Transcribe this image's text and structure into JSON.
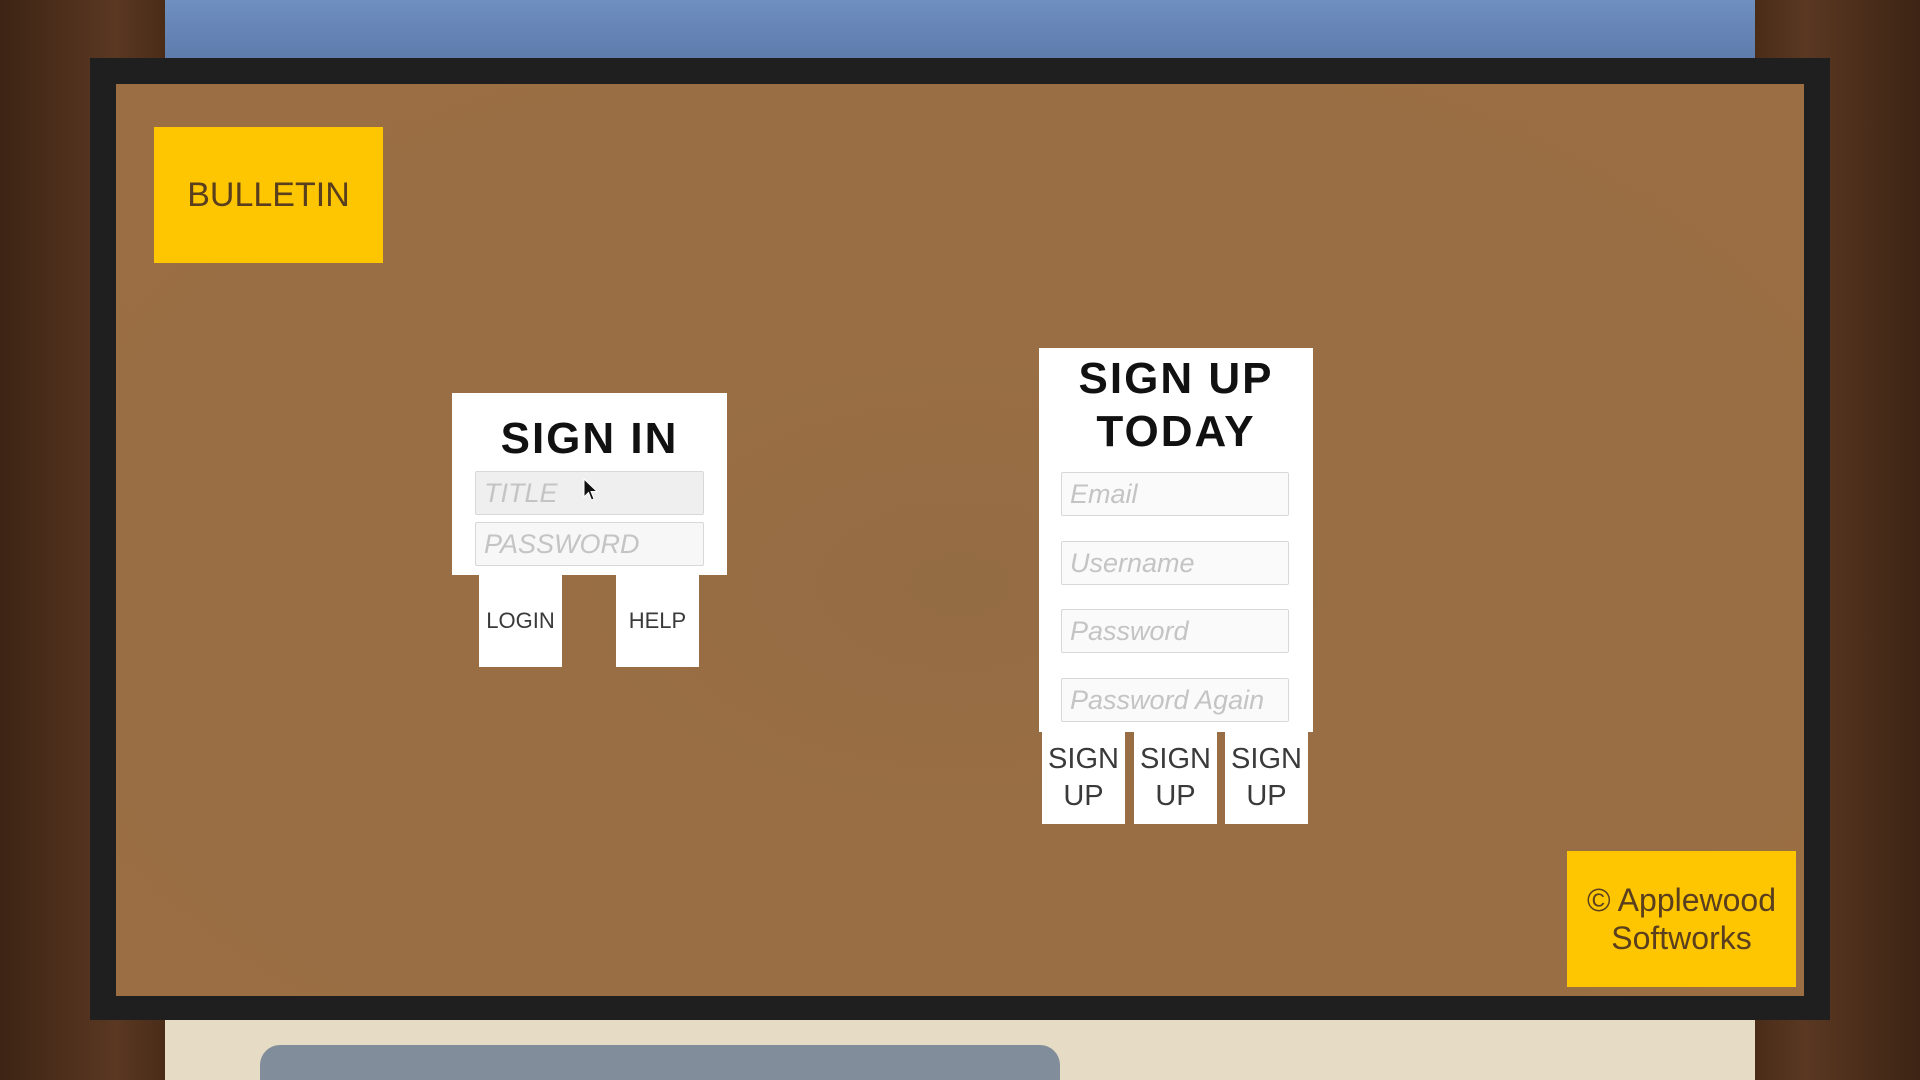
{
  "bulletin": {
    "label": "BULLETIN"
  },
  "sign_in": {
    "title": "SIGN IN",
    "title_placeholder": "TITLE",
    "password_placeholder": "PASSWORD",
    "login_label": "LOGIN",
    "help_label": "HELP"
  },
  "sign_up": {
    "title_line1": "SIGN UP",
    "title_line2": "TODAY",
    "email_placeholder": "Email",
    "username_placeholder": "Username",
    "password_placeholder": "Password",
    "password_again_placeholder": "Password Again",
    "buttons": [
      {
        "line1": "SIGN",
        "line2": "UP"
      },
      {
        "line1": "SIGN",
        "line2": "UP"
      },
      {
        "line1": "SIGN",
        "line2": "UP"
      }
    ]
  },
  "footer": {
    "copyright_line1": "© Applewood",
    "copyright_line2": "Softworks"
  },
  "colors": {
    "board": "#9a6e44",
    "note_yellow": "#fec600",
    "card": "#ffffff"
  }
}
